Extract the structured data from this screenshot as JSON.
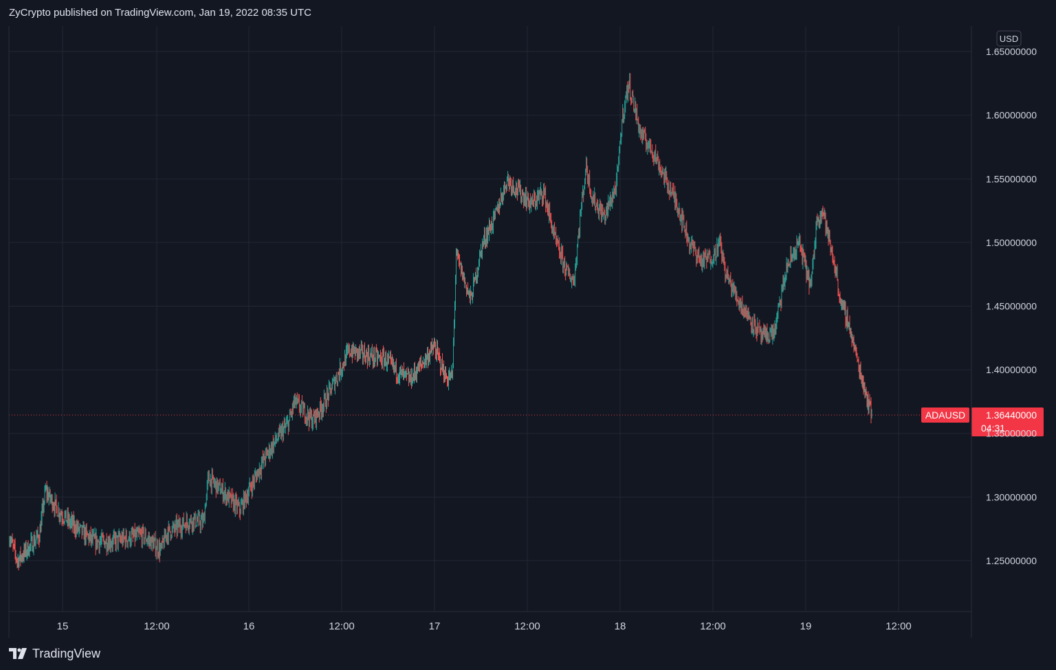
{
  "header": {
    "text": "ZyCrypto published on TradingView.com, Jan 19, 2022 08:35 UTC"
  },
  "footer": {
    "brand": "TradingView"
  },
  "colors": {
    "background": "#131722",
    "grid": "#232734",
    "up": "#26a69a",
    "down": "#ef5350",
    "axis_text": "#d1d4dc",
    "price_label": "#f23645"
  },
  "chart_data": {
    "type": "candlestick",
    "symbol": "ADAUSD",
    "currency": "USD",
    "last_price": "1.36440000",
    "countdown": "04:31",
    "x_ticks": [
      "15",
      "12:00",
      "16",
      "12:00",
      "17",
      "12:00",
      "18",
      "12:00",
      "19",
      "12:00"
    ],
    "y_ticks": [
      "1.25000000",
      "1.30000000",
      "1.35000000",
      "1.40000000",
      "1.45000000",
      "1.50000000",
      "1.55000000",
      "1.60000000",
      "1.65000000"
    ],
    "ylim": [
      1.21,
      1.67
    ],
    "grid": true,
    "path": [
      [
        0,
        1.27
      ],
      [
        0.7,
        1.25
      ],
      [
        2.5,
        1.27
      ],
      [
        3,
        1.305
      ],
      [
        4,
        1.29
      ],
      [
        5,
        1.28
      ],
      [
        7,
        1.265
      ],
      [
        8.5,
        1.265
      ],
      [
        11,
        1.27
      ],
      [
        12.5,
        1.258
      ],
      [
        13,
        1.272
      ],
      [
        15,
        1.282
      ],
      [
        16,
        1.28
      ],
      [
        16.4,
        1.315
      ],
      [
        17.5,
        1.305
      ],
      [
        19,
        1.29
      ],
      [
        20,
        1.31
      ],
      [
        21,
        1.33
      ],
      [
        22,
        1.345
      ],
      [
        23,
        1.358
      ],
      [
        23.5,
        1.375
      ],
      [
        25,
        1.36
      ],
      [
        26,
        1.375
      ],
      [
        27,
        1.395
      ],
      [
        28,
        1.415
      ],
      [
        30,
        1.41
      ],
      [
        31,
        1.408
      ],
      [
        32,
        1.398
      ],
      [
        33,
        1.392
      ],
      [
        34,
        1.405
      ],
      [
        35,
        1.418
      ],
      [
        36,
        1.393
      ],
      [
        36.5,
        1.395
      ],
      [
        36.8,
        1.49
      ],
      [
        38,
        1.455
      ],
      [
        39,
        1.5
      ],
      [
        40,
        1.52
      ],
      [
        41,
        1.55
      ],
      [
        42,
        1.54
      ],
      [
        43,
        1.53
      ],
      [
        44,
        1.54
      ],
      [
        45,
        1.5
      ],
      [
        46,
        1.475
      ],
      [
        46.5,
        1.47
      ],
      [
        47,
        1.52
      ],
      [
        47.5,
        1.56
      ],
      [
        48,
        1.535
      ],
      [
        49,
        1.52
      ],
      [
        50,
        1.545
      ],
      [
        50.5,
        1.6
      ],
      [
        51,
        1.625
      ],
      [
        52,
        1.585
      ],
      [
        53,
        1.572
      ],
      [
        54,
        1.55
      ],
      [
        55,
        1.53
      ],
      [
        56,
        1.5
      ],
      [
        57,
        1.485
      ],
      [
        58,
        1.49
      ],
      [
        58.5,
        1.5
      ],
      [
        59,
        1.475
      ],
      [
        60,
        1.455
      ],
      [
        61,
        1.44
      ],
      [
        62,
        1.425
      ],
      [
        63,
        1.43
      ],
      [
        64,
        1.48
      ],
      [
        65,
        1.5
      ],
      [
        66,
        1.465
      ],
      [
        66.5,
        1.52
      ],
      [
        67,
        1.525
      ],
      [
        67.5,
        1.5
      ],
      [
        68,
        1.48
      ],
      [
        68.5,
        1.45
      ],
      [
        69,
        1.44
      ],
      [
        70,
        1.4
      ],
      [
        71,
        1.365
      ]
    ]
  }
}
